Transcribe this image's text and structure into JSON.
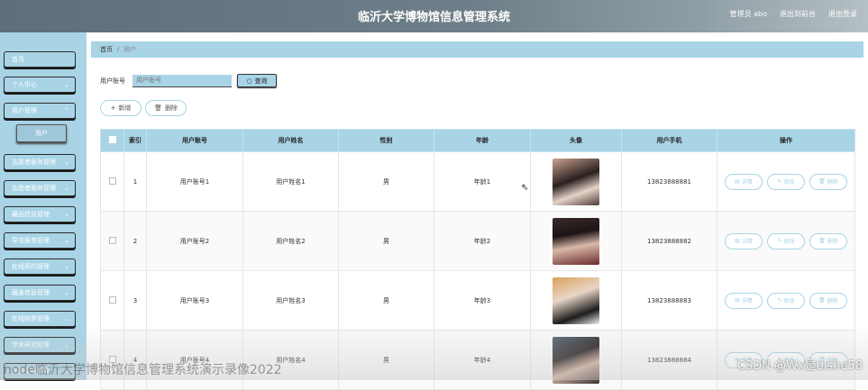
{
  "header": {
    "title": "临沂大学博物馆信息管理系统",
    "user_label": "管理员 abo",
    "front_link": "退出到前台",
    "logout_link": "退出登录"
  },
  "sidebar": {
    "items": [
      {
        "label": "首页",
        "chevron": false
      },
      {
        "label": "个人中心",
        "chevron": true
      },
      {
        "label": "用户管理",
        "chevron": true
      },
      {
        "label": "志愿者服务管理",
        "chevron": true
      },
      {
        "label": "志愿者服务管理",
        "chevron": true
      },
      {
        "label": "藏品信息管理",
        "chevron": true
      },
      {
        "label": "导览服务管理",
        "chevron": true
      },
      {
        "label": "在线预约管理",
        "chevron": true
      },
      {
        "label": "藏身信息管理",
        "chevron": true
      },
      {
        "label": "在线购票管理",
        "chevron": true
      },
      {
        "label": "学术研究管理",
        "chevron": true
      },
      {
        "label": "在线留言管理",
        "chevron": true
      }
    ],
    "sub_item": "用户"
  },
  "breadcrumb": {
    "home": "首页",
    "current": "用户"
  },
  "search": {
    "label": "用户账号",
    "placeholder": "用户账号",
    "button": "查询"
  },
  "actions": {
    "add": "新增",
    "delete": "删除"
  },
  "table": {
    "headers": [
      "",
      "索引",
      "用户账号",
      "用户姓名",
      "性别",
      "年龄",
      "头像",
      "用户手机",
      "操作"
    ],
    "rows": [
      {
        "index": "1",
        "account": "用户账号1",
        "name": "用户姓名1",
        "gender": "男",
        "age": "年龄1",
        "phone": "13823888881"
      },
      {
        "index": "2",
        "account": "用户账号2",
        "name": "用户姓名2",
        "gender": "男",
        "age": "年龄2",
        "phone": "13823888882"
      },
      {
        "index": "3",
        "account": "用户账号3",
        "name": "用户姓名3",
        "gender": "男",
        "age": "年龄3",
        "phone": "13823888883"
      },
      {
        "index": "4",
        "account": "用户账号4",
        "name": "用户姓名4",
        "gender": "男",
        "age": "年龄4",
        "phone": "13823888884"
      }
    ],
    "op_labels": {
      "detail": "详情",
      "edit": "修改",
      "delete": "删除"
    }
  },
  "watermarks": {
    "left": "node临沂大学博物馆信息管理系统演示录像2022",
    "right": "CSDN @Wx是bishe58"
  },
  "colors": {
    "accent": "#a8d4e6",
    "header": "#6f7f89"
  }
}
